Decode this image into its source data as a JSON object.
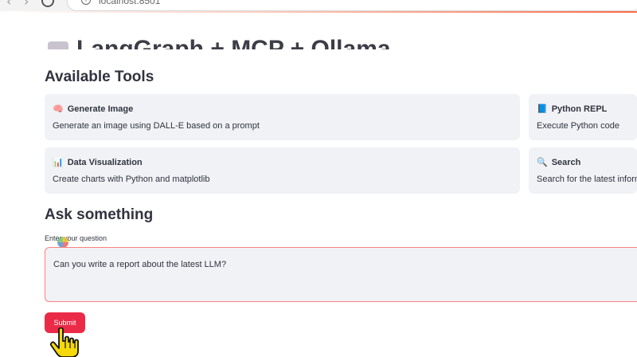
{
  "browser": {
    "url": "localhost:8501",
    "back_icon": "arrow-left-icon",
    "forward_icon": "arrow-right-icon",
    "reload_icon": "reload-icon",
    "site_info_icon": "info-icon"
  },
  "app": {
    "title": "LangGraph + MCP + Ollama"
  },
  "tools": {
    "heading": "Available Tools",
    "items": [
      {
        "emoji": "🧠",
        "name": "Generate Image",
        "description": "Generate an image using DALL-E based on a prompt"
      },
      {
        "emoji": "📘",
        "name": "Python REPL",
        "description": "Execute Python code"
      },
      {
        "emoji": "📊",
        "name": "Data Visualization",
        "description": "Create charts with Python and matplotlib"
      },
      {
        "emoji": "🔍",
        "name": "Search",
        "description": "Search for the latest inform"
      }
    ]
  },
  "ask": {
    "heading": "Ask something",
    "field_label": "Enter your question",
    "question_value": "Can you write a report about the latest LLM?",
    "submit_label": "Submit"
  },
  "colors": {
    "accent": "#ea2b47",
    "card_background": "#f0f2f6",
    "textarea_border": "#ff8080"
  }
}
